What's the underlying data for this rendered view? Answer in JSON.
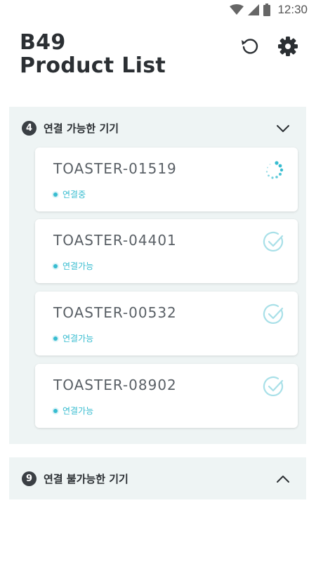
{
  "status_bar": {
    "time": "12:30"
  },
  "header": {
    "title_line1": "B49",
    "title_line2": "Product List"
  },
  "colors": {
    "accent": "#37bcd0",
    "panel": "#eef4f4",
    "badge": "#3a3f44"
  },
  "available": {
    "count": "4",
    "title": "연결 가능한 기기",
    "devices": [
      {
        "name": "TOASTER-01519",
        "status": "연결중",
        "icon": "loading-spinner-icon"
      },
      {
        "name": "TOASTER-04401",
        "status": "연결가능",
        "icon": "check-circle-icon"
      },
      {
        "name": "TOASTER-00532",
        "status": "연결가능",
        "icon": "check-circle-icon"
      },
      {
        "name": "TOASTER-08902",
        "status": "연결가능",
        "icon": "check-circle-icon"
      }
    ]
  },
  "unavailable": {
    "count": "9",
    "title": "연결 불가능한 기기"
  }
}
